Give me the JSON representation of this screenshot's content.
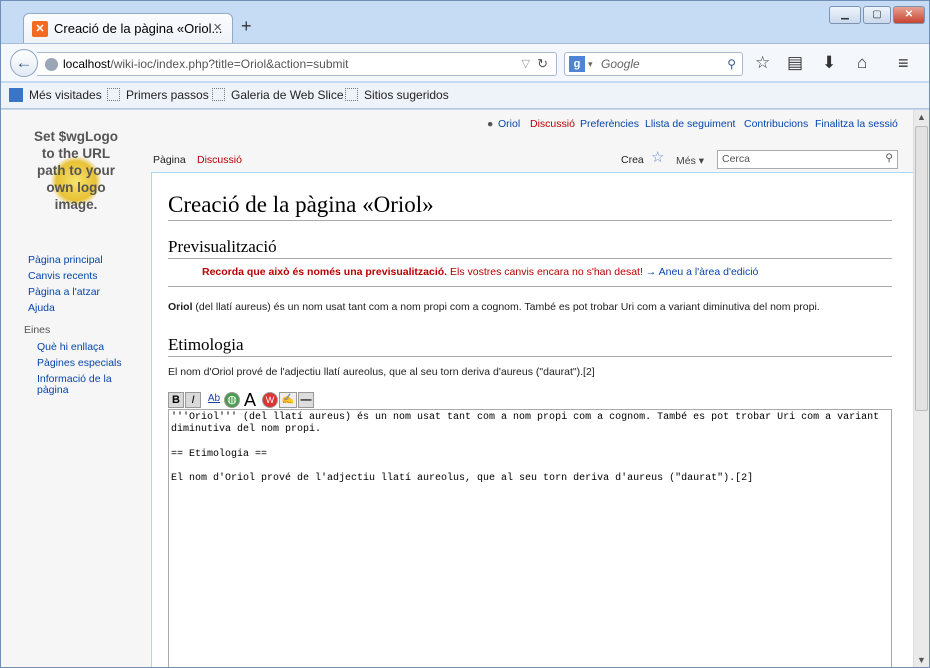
{
  "tab": {
    "title": "Creació de la pàgina «Oriol..."
  },
  "url": {
    "host": "localhost",
    "path": "/wiki-ioc/index.php?title=Oriol&action=submit"
  },
  "search": {
    "engine_icon": "google-icon",
    "placeholder": "Google"
  },
  "bookmarks": [
    "Més visitades",
    "Primers passos",
    "Galeria de Web Slice",
    "Sitios sugeridos"
  ],
  "logo": {
    "lines": [
      "Set $wgLogo",
      "to the URL",
      "path to your",
      "own logo",
      "image."
    ]
  },
  "personal": [
    "Oriol",
    "Discussió",
    "Preferències",
    "Llista de seguiment",
    "Contribucions",
    "Finalitza la sessió"
  ],
  "tabs": {
    "page": "Pàgina",
    "talk": "Discussió",
    "create": "Crea",
    "more": "Més ▾",
    "search_placeholder": "Cerca"
  },
  "sidebar": {
    "nav": [
      "Pàgina principal",
      "Canvis recents",
      "Pàgina a l'atzar",
      "Ajuda"
    ],
    "tools_heading": "Eines",
    "tools": [
      "Què hi enllaça",
      "Pàgines especials",
      "Informació de la",
      "pàgina"
    ]
  },
  "page": {
    "title": "Creació de la pàgina «Oriol»",
    "preview_heading": "Previsualització",
    "preview_bold": "Recorda que això és només una previsualització.",
    "preview_rest": " Els vostres canvis encara no s'han desat!",
    "preview_link": "→ Aneu a l'àrea d'edició",
    "para1_bold": "Oriol",
    "para1": " (del llatí aureus) és un nom usat tant com a nom propi com a cognom. També es pot trobar Uri com a variant diminutiva del nom propi.",
    "etim_heading": "Etimologia",
    "para2": "El nom d'Oriol prové de l'adjectiu llatí aureolus, que al seu torn deriva d'aureus (\"daurat\").[2]"
  },
  "editor": {
    "text": "'''Oriol''' (del llatí aureus) és un nom usat tant com a nom propi com a cognom. També es pot trobar Uri com a variant diminutiva del nom propi.\n\n== Etimologia ==\n\nEl nom d'Oriol prové de l'adjectiu llatí aureolus, que al seu torn deriva d'aureus (\"daurat\").[2]"
  }
}
